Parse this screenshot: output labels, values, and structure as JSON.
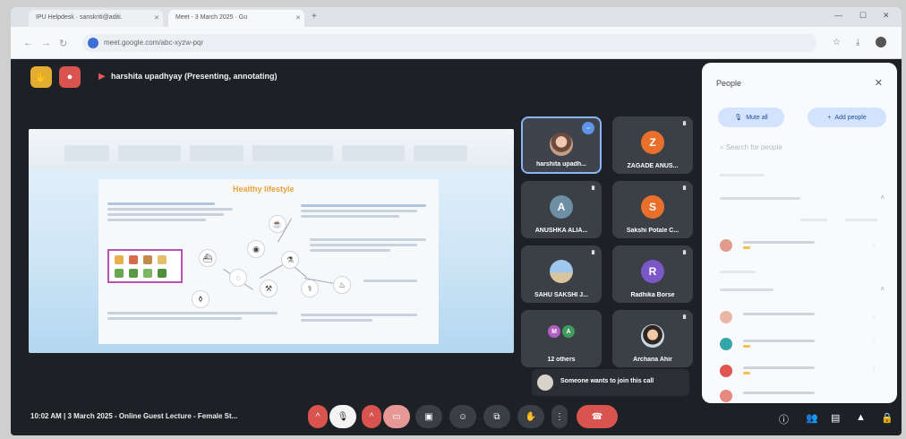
{
  "browser": {
    "tabs": [
      {
        "label": "IPU Helpdesk · sanskriti@aditi.",
        "active": false
      },
      {
        "label": "Meet - 3 March 2025 · Gu",
        "active": true
      }
    ],
    "url": "meet.google.com/abc-xyzw-pqr"
  },
  "meet": {
    "presenter_status": "harshita upadhyay (Presenting, annotating)",
    "slide": {
      "title": "Healthy lifestyle"
    },
    "tiles": [
      {
        "name": "harshita upadh...",
        "avatar": "photo",
        "initial": "",
        "color": "",
        "active": true
      },
      {
        "name": "ZAGADE ANUS...",
        "avatar": "initial",
        "initial": "Z",
        "color": "#e8702a",
        "active": false
      },
      {
        "name": "ANUSHKA ALIA...",
        "avatar": "initial",
        "initial": "A",
        "color": "#6c8fa3",
        "active": false
      },
      {
        "name": "Sakshi Potale C...",
        "avatar": "initial",
        "initial": "S",
        "color": "#e8702a",
        "active": false
      },
      {
        "name": "SAHU SAKSHI J...",
        "avatar": "sky",
        "initial": "",
        "color": "",
        "active": false
      },
      {
        "name": "Radhika Borse",
        "avatar": "initial",
        "initial": "R",
        "color": "#7b57c7",
        "active": false
      },
      {
        "name": "12 others",
        "avatar": "group",
        "initial": "",
        "color": "",
        "active": false
      },
      {
        "name": "Archana Ahir",
        "avatar": "woman",
        "initial": "",
        "color": "",
        "active": false
      }
    ],
    "join_toast": "Someone wants to join this call",
    "bottom": {
      "meeting_info": "10:02 AM  |  3 March 2025 - Online Guest Lecture - Female St..."
    }
  },
  "people": {
    "title": "People",
    "mute_all": "Mute all",
    "add_people": "Add people",
    "search_placeholder": "Search for people"
  },
  "colors": {
    "meet_bg": "#1d2125",
    "tile_bg": "#3b4047",
    "accent_blue": "#8ab4f8",
    "end_call_red": "#d9534f",
    "panel_bg": "#f8fafd"
  }
}
